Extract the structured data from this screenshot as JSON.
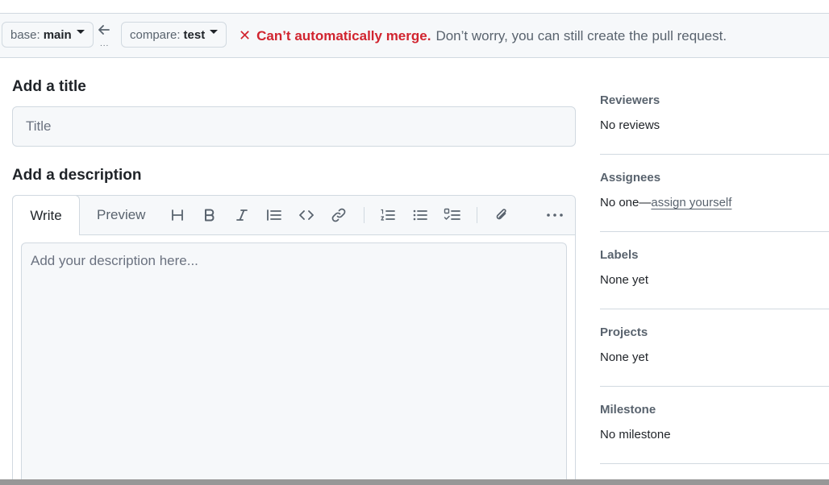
{
  "compare_bar": {
    "base_prefix": "base:",
    "base_branch": "main",
    "compare_prefix": "compare:",
    "compare_branch": "test",
    "dots": "...",
    "merge_status": "Can’t automatically merge.",
    "merge_info": "Don’t worry, you can still create the pull request.",
    "status_color": "#d1242f"
  },
  "form": {
    "title_heading": "Add a title",
    "title_placeholder": "Title",
    "description_heading": "Add a description",
    "description_placeholder": "Add your description here..."
  },
  "editor": {
    "tabs": [
      "Write",
      "Preview"
    ],
    "active_tab": "Write",
    "toolbar": [
      "heading-icon",
      "bold-icon",
      "italic-icon",
      "quote-icon",
      "code-icon",
      "link-icon",
      "numbered-list-icon",
      "unordered-list-icon",
      "task-list-icon",
      "attach-icon",
      "more-icon"
    ]
  },
  "sidebar": {
    "sections": [
      {
        "title": "Reviewers",
        "value": "No reviews"
      },
      {
        "title": "Assignees",
        "value": "No one—",
        "link": "assign yourself"
      },
      {
        "title": "Labels",
        "value": "None yet"
      },
      {
        "title": "Projects",
        "value": "None yet"
      },
      {
        "title": "Milestone",
        "value": "No milestone"
      }
    ]
  }
}
